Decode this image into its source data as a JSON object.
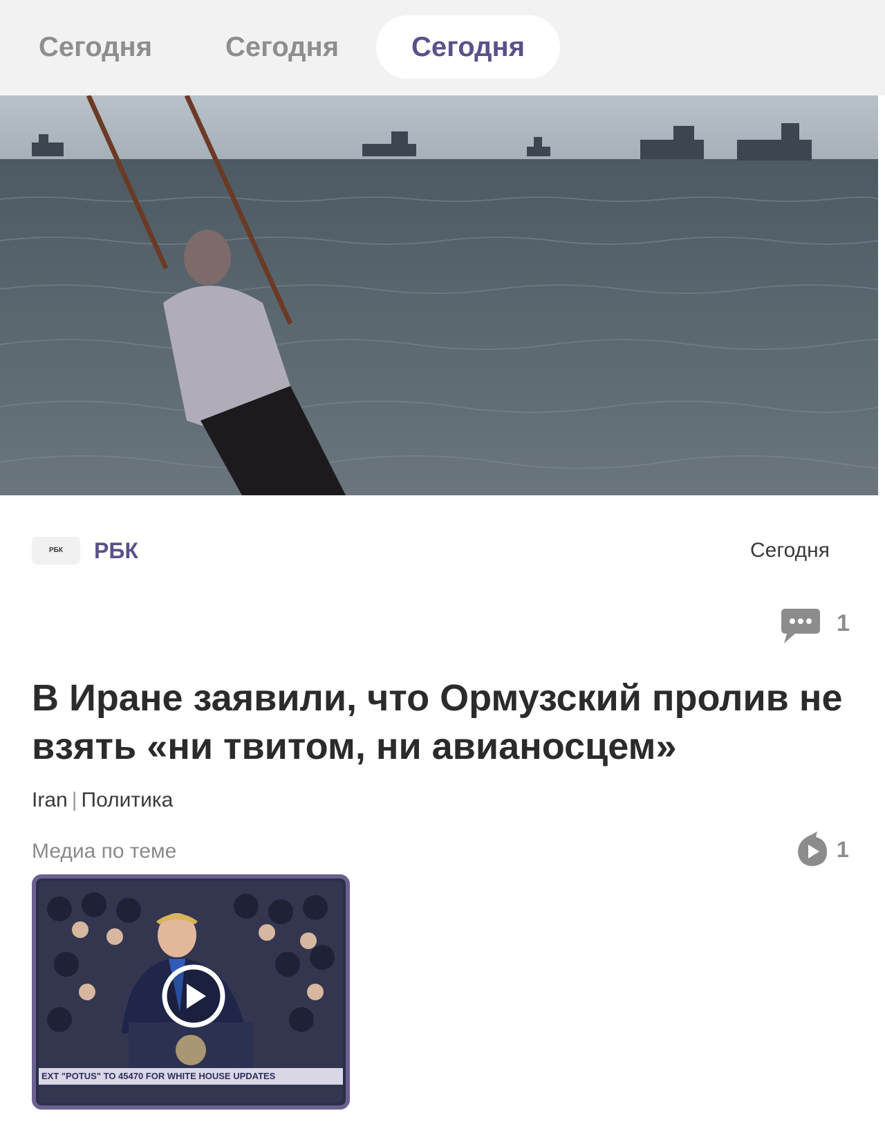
{
  "tabs": [
    {
      "label": "Сегодня",
      "active": false
    },
    {
      "label": "Сегодня",
      "active": false
    },
    {
      "label": "Сегодня",
      "active": true
    }
  ],
  "colors": {
    "accent": "#5b5088",
    "tab_bg": "#f2f2f2",
    "muted": "#8e8e8e",
    "text": "#2b2b2b"
  },
  "article": {
    "source_logo": "РБК",
    "source_name": "РБК",
    "date": "Сегодня",
    "comments_count": "1",
    "headline": "В Иране заявили, что Ормузский пролив не взять «ни твитом, ни авианосцем»",
    "tags": [
      "Iran",
      "Политика"
    ],
    "media_label": "Медиа по теме",
    "media_count": "1",
    "video_ticker": "EXT \"POTUS\" TO 45470 FOR WHITE HOUSE UPDATES"
  },
  "icons": {
    "comments": "speech-bubble-icon",
    "media": "play-badge-icon",
    "video": "play-circle-icon"
  }
}
